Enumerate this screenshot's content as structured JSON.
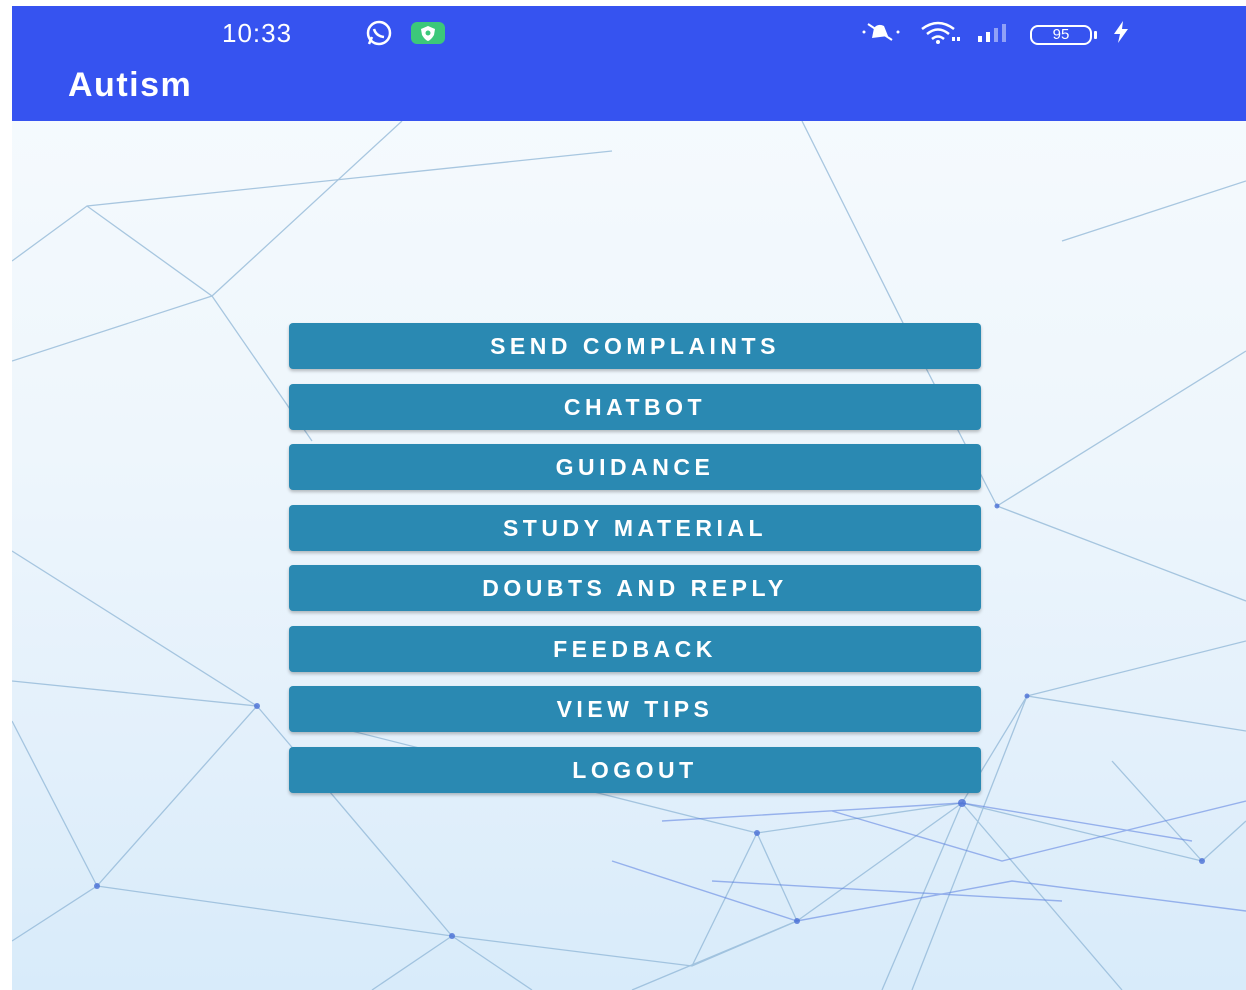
{
  "status_bar": {
    "time": "10:33",
    "battery_level": "95",
    "icons": [
      "whatsapp-icon",
      "shield-icon",
      "mute-icon",
      "wifi-icon",
      "signal-icon",
      "battery-icon",
      "charging-icon"
    ]
  },
  "app_bar": {
    "title": "Autism",
    "color": "#3653f0"
  },
  "menu": {
    "button_color": "#2a89b2",
    "items": [
      {
        "label": "SEND COMPLAINTS"
      },
      {
        "label": "CHATBOT"
      },
      {
        "label": "GUIDANCE"
      },
      {
        "label": "STUDY MATERIAL"
      },
      {
        "label": "DOUBTS AND REPLY"
      },
      {
        "label": "FEEDBACK"
      },
      {
        "label": "VIEW TIPS"
      },
      {
        "label": "LOGOUT"
      }
    ]
  }
}
